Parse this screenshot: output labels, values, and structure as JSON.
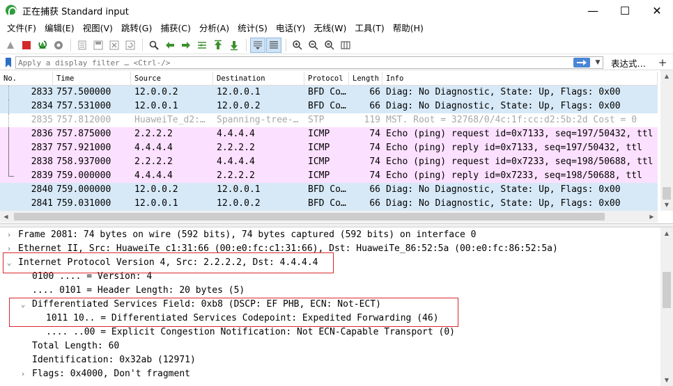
{
  "window": {
    "title": "正在捕获 Standard input",
    "minimize": "—",
    "maximize": "☐",
    "close": "✕"
  },
  "menu": [
    "文件(F)",
    "编辑(E)",
    "视图(V)",
    "跳转(G)",
    "捕获(C)",
    "分析(A)",
    "统计(S)",
    "电话(Y)",
    "无线(W)",
    "工具(T)",
    "帮助(H)"
  ],
  "toolbar": [
    {
      "name": "start-capture-icon",
      "color": "#9a9a9a"
    },
    {
      "name": "stop-capture-icon",
      "color": "#d22a2a"
    },
    {
      "name": "restart-capture-icon",
      "color": "#3aa83a"
    },
    {
      "name": "capture-options-icon",
      "color": "#8a8a8a"
    },
    {
      "name": "open-file-icon",
      "color": "#9a9a9a"
    },
    {
      "name": "save-file-icon",
      "color": "#9a9a9a"
    },
    {
      "name": "close-file-icon",
      "color": "#9a9a9a"
    },
    {
      "name": "reload-file-icon",
      "color": "#9a9a9a"
    },
    {
      "name": "find-packet-icon",
      "color": "#3a3a3a"
    },
    {
      "name": "go-back-icon",
      "color": "#3f8f2f"
    },
    {
      "name": "go-forward-icon",
      "color": "#3f8f2f"
    },
    {
      "name": "go-to-packet-icon",
      "color": "#3f8f2f"
    },
    {
      "name": "go-first-icon",
      "color": "#3f8f2f"
    },
    {
      "name": "go-last-icon",
      "color": "#3f8f2f"
    },
    {
      "name": "autoscroll-icon",
      "color": "#444444"
    },
    {
      "name": "colorize-icon",
      "color": "#444444"
    },
    {
      "name": "zoom-in-icon",
      "color": "#3a3a3a"
    },
    {
      "name": "zoom-out-icon",
      "color": "#3a3a3a"
    },
    {
      "name": "zoom-normal-icon",
      "color": "#3a3a3a"
    },
    {
      "name": "resize-columns-icon",
      "color": "#3a3a3a"
    }
  ],
  "filter": {
    "placeholder": "Apply a display filter … <Ctrl-/>",
    "expression_label": "表达式…",
    "add_label": "+"
  },
  "columns": [
    "No.",
    "Time",
    "Source",
    "Destination",
    "Protocol",
    "Length",
    "Info"
  ],
  "packets": [
    {
      "no": "2833",
      "time": "757.500000",
      "src": "12.0.0.2",
      "dst": "12.0.0.1",
      "proto": "BFD Co…",
      "len": "66",
      "info": "Diag: No Diagnostic, State: Up, Flags: 0x00",
      "kind": "bfd",
      "rel": "dot"
    },
    {
      "no": "2834",
      "time": "757.531000",
      "src": "12.0.0.1",
      "dst": "12.0.0.2",
      "proto": "BFD Co…",
      "len": "66",
      "info": "Diag: No Diagnostic, State: Up, Flags: 0x00",
      "kind": "bfd",
      "rel": "dot"
    },
    {
      "no": "2835",
      "time": "757.812000",
      "src": "HuaweiTe_d2:…",
      "dst": "Spanning-tree-…",
      "proto": "STP",
      "len": "119",
      "info": "MST. Root = 32768/0/4c:1f:cc:d2:5b:2d  Cost = 0",
      "kind": "stp",
      "rel": "dot"
    },
    {
      "no": "2836",
      "time": "757.875000",
      "src": "2.2.2.2",
      "dst": "4.4.4.4",
      "proto": "ICMP",
      "len": "74",
      "info": "Echo (ping) request  id=0x7133, seq=197/50432, ttl",
      "kind": "icmp",
      "rel": "line"
    },
    {
      "no": "2837",
      "time": "757.921000",
      "src": "4.4.4.4",
      "dst": "2.2.2.2",
      "proto": "ICMP",
      "len": "74",
      "info": "Echo (ping) reply    id=0x7133, seq=197/50432, ttl",
      "kind": "icmp",
      "rel": "line"
    },
    {
      "no": "2838",
      "time": "758.937000",
      "src": "2.2.2.2",
      "dst": "4.4.4.4",
      "proto": "ICMP",
      "len": "74",
      "info": "Echo (ping) request  id=0x7233, seq=198/50688, ttl",
      "kind": "icmp",
      "rel": "line"
    },
    {
      "no": "2839",
      "time": "759.000000",
      "src": "4.4.4.4",
      "dst": "2.2.2.2",
      "proto": "ICMP",
      "len": "74",
      "info": "Echo (ping) reply    id=0x7233, seq=198/50688, ttl",
      "kind": "icmp",
      "rel": "end"
    },
    {
      "no": "2840",
      "time": "759.000000",
      "src": "12.0.0.2",
      "dst": "12.0.0.1",
      "proto": "BFD Co…",
      "len": "66",
      "info": "Diag: No Diagnostic, State: Up, Flags: 0x00",
      "kind": "bfd",
      "rel": "none"
    },
    {
      "no": "2841",
      "time": "759.031000",
      "src": "12.0.0.1",
      "dst": "12.0.0.2",
      "proto": "BFD Co…",
      "len": "66",
      "info": "Diag: No Diagnostic, State: Up, Flags: 0x00",
      "kind": "bfd",
      "rel": "none"
    }
  ],
  "details": [
    {
      "indent": 0,
      "toggle": "›",
      "text": "Frame 2081: 74 bytes on wire (592 bits), 74 bytes captured (592 bits) on interface 0"
    },
    {
      "indent": 0,
      "toggle": "›",
      "text": "Ethernet II, Src: HuaweiTe_c1:31:66 (00:e0:fc:c1:31:66), Dst: HuaweiTe_86:52:5a (00:e0:fc:86:52:5a)"
    },
    {
      "indent": 0,
      "toggle": "⌄",
      "text": "Internet Protocol Version 4, Src: 2.2.2.2, Dst: 4.4.4.4"
    },
    {
      "indent": 1,
      "toggle": "",
      "text": "0100 .... = Version: 4"
    },
    {
      "indent": 1,
      "toggle": "",
      "text": ".... 0101 = Header Length: 20 bytes (5)"
    },
    {
      "indent": 1,
      "toggle": "⌄",
      "text": "Differentiated Services Field: 0xb8 (DSCP: EF PHB, ECN: Not-ECT)"
    },
    {
      "indent": 2,
      "toggle": "",
      "text": "1011 10.. = Differentiated Services Codepoint: Expedited Forwarding (46)"
    },
    {
      "indent": 2,
      "toggle": "",
      "text": ".... ..00 = Explicit Congestion Notification: Not ECN-Capable Transport (0)"
    },
    {
      "indent": 1,
      "toggle": "",
      "text": "Total Length: 60"
    },
    {
      "indent": 1,
      "toggle": "",
      "text": "Identification: 0x32ab (12971)"
    },
    {
      "indent": 1,
      "toggle": "›",
      "text": "Flags: 0x4000, Don't fragment"
    }
  ],
  "colors": {
    "bfd_row": "#d7e9f7",
    "icmp_row": "#fce0ff",
    "stp_text": "#a8a8a8",
    "highlight_box": "#d9262b",
    "apply_button": "#4a86d6"
  }
}
